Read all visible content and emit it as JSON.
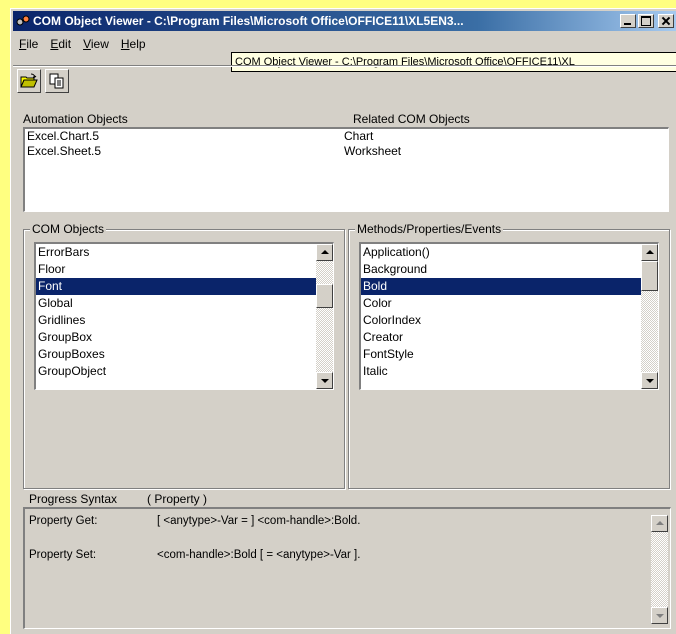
{
  "window": {
    "title": "COM Object Viewer - C:\\Program Files\\Microsoft Office\\OFFICE11\\XL5EN3...",
    "tooltip": "COM Object Viewer - C:\\Program Files\\Microsoft Office\\OFFICE11\\XL"
  },
  "menu": [
    {
      "accel": "F",
      "rest": "ile"
    },
    {
      "accel": "E",
      "rest": "dit"
    },
    {
      "accel": "V",
      "rest": "iew"
    },
    {
      "accel": "H",
      "rest": "elp"
    }
  ],
  "automation": {
    "header_left": "Automation Objects",
    "header_right": "Related COM Objects",
    "rows": [
      {
        "object": "Excel.Chart.5",
        "related": "Chart"
      },
      {
        "object": "Excel.Sheet.5",
        "related": "Worksheet"
      }
    ]
  },
  "com_objects": {
    "title": "COM Objects",
    "items": [
      "ErrorBars",
      "Floor",
      "Font",
      "Global",
      "Gridlines",
      "GroupBox",
      "GroupBoxes",
      "GroupObject"
    ],
    "selected": "Font"
  },
  "methods": {
    "title": "Methods/Properties/Events",
    "items": [
      "Application()",
      "Background",
      "Bold",
      "Color",
      "ColorIndex",
      "Creator",
      "FontStyle",
      "Italic"
    ],
    "selected": "Bold"
  },
  "syntax": {
    "label": "Progress Syntax",
    "kind": "( Property )",
    "get_label": "Property Get:",
    "get_value": "[ <anytype>-Var = ] <com-handle>:Bold.",
    "set_label": "Property Set:",
    "set_value": "<com-handle>:Bold [ = <anytype>-Var ]."
  }
}
